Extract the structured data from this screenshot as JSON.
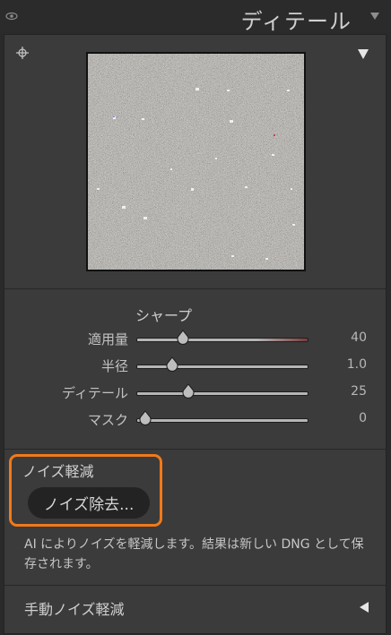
{
  "header": {
    "title": "ディテール",
    "visibility_icon": "eye-icon",
    "collapse_icon": "triangle-down-icon"
  },
  "preview": {
    "target_icon": "crosshair-icon",
    "menu_icon": "triangle-down-icon"
  },
  "sharpen": {
    "title": "シャープ",
    "sliders": [
      {
        "label": "適用量",
        "value": "40",
        "fraction": 0.27
      },
      {
        "label": "半径",
        "value": "1.0",
        "fraction": 0.21
      },
      {
        "label": "ディテール",
        "value": "25",
        "fraction": 0.3
      },
      {
        "label": "マスク",
        "value": "0",
        "fraction": 0.05
      }
    ]
  },
  "noise_reduction": {
    "heading": "ノイズ軽減",
    "denoise_button": "ノイズ除去...",
    "description": "AI によりノイズを軽減します。結果は新しい DNG として保存されます。",
    "highlight_color": "#f07a1a"
  },
  "manual": {
    "label": "手動ノイズ軽減",
    "expand_icon": "triangle-left-icon"
  }
}
